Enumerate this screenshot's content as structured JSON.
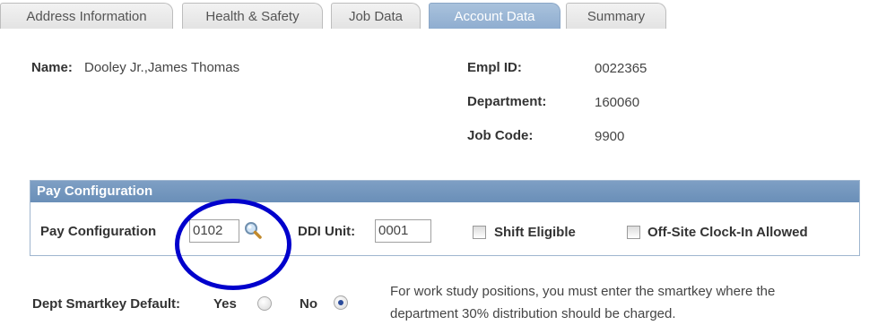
{
  "tabs": [
    {
      "label": "Address Information"
    },
    {
      "label": "Health & Safety"
    },
    {
      "label": "Job Data"
    },
    {
      "label": "Account Data"
    },
    {
      "label": "Summary"
    }
  ],
  "active_tab": "Account Data",
  "header": {
    "name_label": "Name:",
    "name_value": "Dooley Jr.,James Thomas",
    "empl_id_label": "Empl ID:",
    "empl_id_value": "0022365",
    "department_label": "Department:",
    "department_value": "160060",
    "job_code_label": "Job Code:",
    "job_code_value": "9900"
  },
  "pay_config": {
    "section_title": "Pay Configuration",
    "field_label": "Pay Configuration",
    "field_value": "0102",
    "ddi_label": "DDI Unit:",
    "ddi_value": "0001",
    "shift_label": "Shift Eligible",
    "offsite_label": "Off-Site Clock-In Allowed"
  },
  "smartkey": {
    "label": "Dept Smartkey Default:",
    "yes_label": "Yes",
    "no_label": "No",
    "selected": "No",
    "note_line1": "For work study positions, you must enter the smartkey where the",
    "note_line2": "department 30% distribution should be charged."
  },
  "colors": {
    "active_tab": "#8fadd0",
    "section_header": "#6a8fb8",
    "annotation": "#0000cc"
  }
}
